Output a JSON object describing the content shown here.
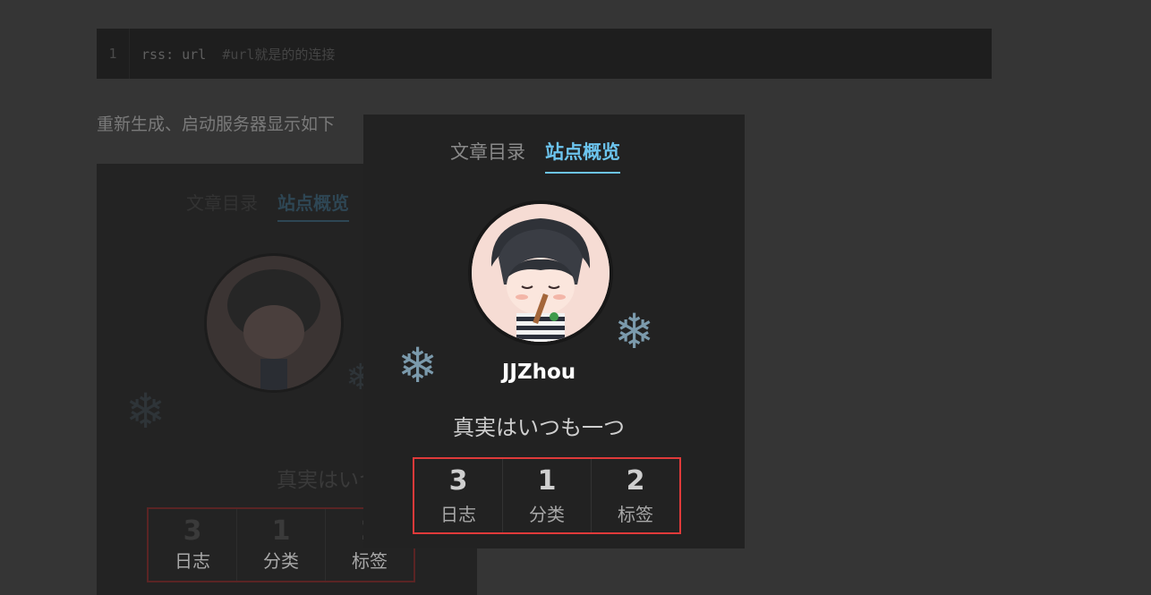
{
  "code": {
    "line_number": "1",
    "code_text": "rss: url  ",
    "comment_text": "#url就是的的连接"
  },
  "paragraph": "重新生成、启动服务器显示如下",
  "sidebar": {
    "tabs": [
      {
        "label": "文章目录"
      },
      {
        "label": "站点概览"
      }
    ],
    "author_name": "JJZhou",
    "motto": "真実はいつも一つ",
    "stats": [
      {
        "count": "3",
        "label": "日志"
      },
      {
        "count": "1",
        "label": "分类"
      },
      {
        "count": "2",
        "label": "标签"
      }
    ],
    "accent_color": "#6cc4ee",
    "highlight_box_color": "#e03a3a"
  },
  "icons": {
    "snowflake": "snowflake-icon",
    "avatar": "avatar-image"
  }
}
